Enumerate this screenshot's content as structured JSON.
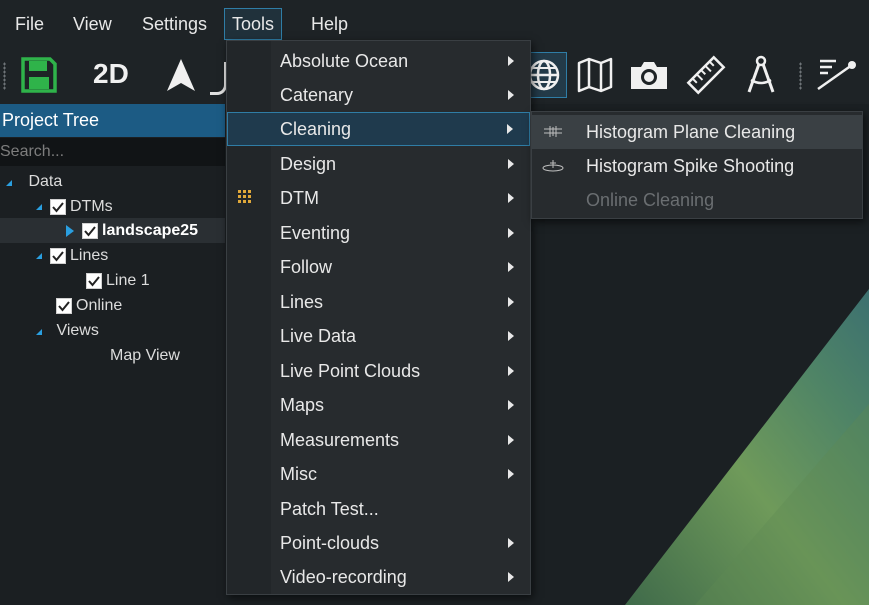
{
  "menubar": {
    "items": [
      {
        "label": "File"
      },
      {
        "label": "View"
      },
      {
        "label": "Settings"
      },
      {
        "label": "Tools",
        "active": true
      },
      {
        "label": "Help"
      }
    ]
  },
  "toolbar": {
    "mode_2d_label": "2D",
    "accent_green": "#2fb34a",
    "icons": [
      "save-icon",
      "north-arrow-icon",
      "globe-icon",
      "map-icon",
      "camera-icon",
      "ruler-icon",
      "compass-icon",
      "survey-line-icon"
    ]
  },
  "project_tree": {
    "title": "Project Tree",
    "search_placeholder": "Search...",
    "nodes": [
      {
        "label": "Data",
        "expanded": true
      },
      {
        "label": "DTMs",
        "checked": true,
        "expanded": true
      },
      {
        "label": "landscape25",
        "checked": true,
        "expanded": false,
        "bold": true,
        "selected": true
      },
      {
        "label": "Lines",
        "checked": true,
        "expanded": true
      },
      {
        "label": "Line 1",
        "checked": true
      },
      {
        "label": "Online",
        "checked": true
      },
      {
        "label": "Views",
        "expanded": true
      },
      {
        "label": "Map View"
      }
    ]
  },
  "tools_menu": {
    "items": [
      {
        "label": "Absolute Ocean",
        "submenu": true
      },
      {
        "label": "Catenary",
        "submenu": true
      },
      {
        "label": "Cleaning",
        "submenu": true,
        "highlighted": true
      },
      {
        "label": "Design",
        "submenu": true
      },
      {
        "label": "DTM",
        "submenu": true,
        "icon": "grid-dots-icon"
      },
      {
        "label": "Eventing",
        "submenu": true
      },
      {
        "label": "Follow",
        "submenu": true
      },
      {
        "label": "Lines",
        "submenu": true
      },
      {
        "label": "Live Data",
        "submenu": true
      },
      {
        "label": "Live Point Clouds",
        "submenu": true
      },
      {
        "label": "Maps",
        "submenu": true
      },
      {
        "label": "Measurements",
        "submenu": true
      },
      {
        "label": "Misc",
        "submenu": true
      },
      {
        "label": "Patch Test...",
        "submenu": false
      },
      {
        "label": "Point-clouds",
        "submenu": true
      },
      {
        "label": "Video-recording",
        "submenu": true
      }
    ]
  },
  "cleaning_submenu": {
    "items": [
      {
        "label": "Histogram Plane Cleaning",
        "highlighted": true,
        "icon": "plane-cleaning-icon"
      },
      {
        "label": "Histogram Spike Shooting",
        "icon": "spike-shooting-icon"
      },
      {
        "label": "Online Cleaning",
        "disabled": true
      }
    ]
  },
  "colors": {
    "accent_blue": "#1c5b84",
    "highlight_border": "#2f7da6",
    "terrain_green": "#6f9a5a"
  }
}
